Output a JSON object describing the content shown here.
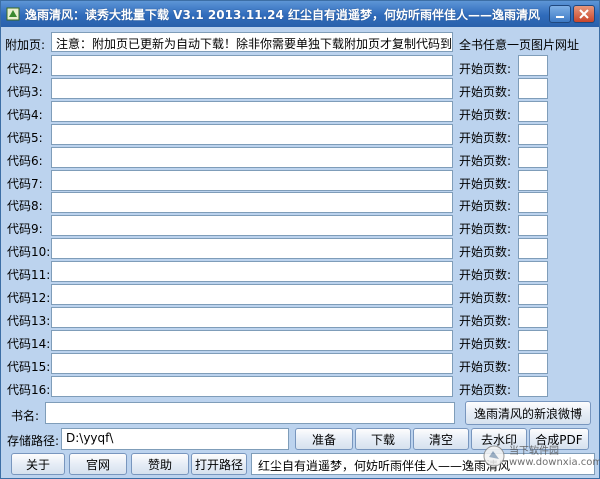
{
  "window": {
    "title": "逸雨清风：读秀大批量下载 V3.1   2013.11.24   红尘自有逍遥梦，何妨听雨伴佳人——逸雨清风"
  },
  "attach": {
    "label": "附加页:",
    "value": "注意：附加页已更新为自动下载！除非你需要单独下载附加页才复制代码到此",
    "side_label": "全书任意一页图片网址"
  },
  "codes": [
    {
      "label": "代码2:",
      "start_label": "开始页数:"
    },
    {
      "label": "代码3:",
      "start_label": "开始页数:"
    },
    {
      "label": "代码4:",
      "start_label": "开始页数:"
    },
    {
      "label": "代码5:",
      "start_label": "开始页数:"
    },
    {
      "label": "代码6:",
      "start_label": "开始页数:"
    },
    {
      "label": "代码7:",
      "start_label": "开始页数:"
    },
    {
      "label": "代码8:",
      "start_label": "开始页数:"
    },
    {
      "label": "代码9:",
      "start_label": "开始页数:"
    },
    {
      "label": "代码10:",
      "start_label": "开始页数:"
    },
    {
      "label": "代码11:",
      "start_label": "开始页数:"
    },
    {
      "label": "代码12:",
      "start_label": "开始页数:"
    },
    {
      "label": "代码13:",
      "start_label": "开始页数:"
    },
    {
      "label": "代码14:",
      "start_label": "开始页数:"
    },
    {
      "label": "代码15:",
      "start_label": "开始页数:"
    },
    {
      "label": "代码16:",
      "start_label": "开始页数:"
    }
  ],
  "book": {
    "label": "书名:",
    "weibo_button": "逸雨清风的新浪微博"
  },
  "path": {
    "label": "存储路径:",
    "value": "D:\\yyqf\\"
  },
  "actions": {
    "prepare": "准备",
    "download": "下载",
    "clear": "清空",
    "remove_watermark": "去水印",
    "merge_pdf": "合成PDF"
  },
  "footer": {
    "about": "关于",
    "website": "官网",
    "donate": "赞助",
    "open_path": "打开路径",
    "status": "红尘自有逍遥梦，何妨听雨伴佳人——逸雨清风"
  },
  "watermark": {
    "line1": "当下软件园",
    "line2": "www.downxia.com"
  },
  "colors": {
    "titlebar": "#2f6bbb",
    "client_bg": "#bcd3ee"
  }
}
